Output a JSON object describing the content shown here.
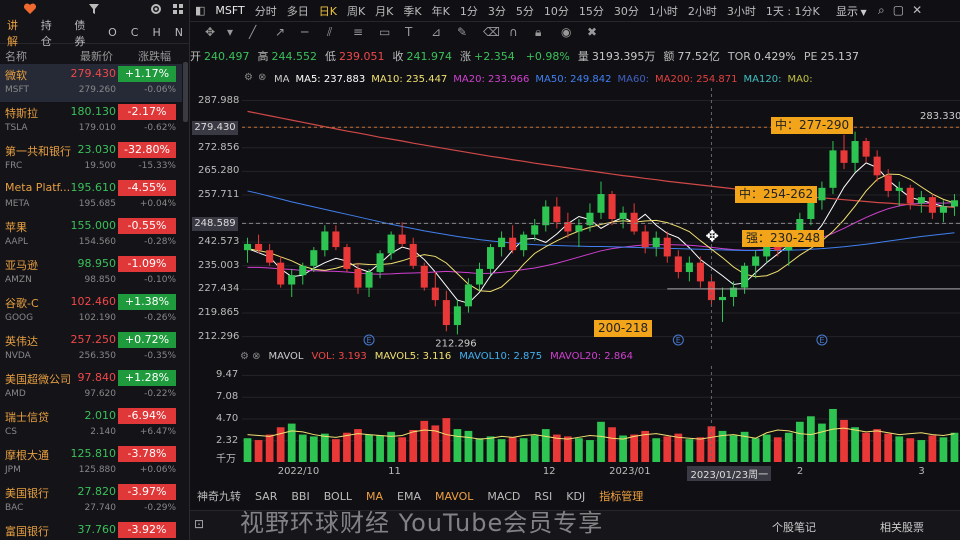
{
  "toolbar_left": {
    "heart_icon": "heart-icon",
    "filter_icon": "filter-icon",
    "gear_icon": "gear-icon",
    "grid_icon": "grid-icon"
  },
  "tabs": [
    "讲解",
    "持仓",
    "债券",
    "O",
    "C",
    "H",
    "N"
  ],
  "tab_active": 0,
  "column_headers": {
    "name": "名称",
    "price": "最新价",
    "change": "涨跌幅"
  },
  "watchlist": [
    {
      "name": "微软",
      "code": "MSFT",
      "price": "279.430",
      "pre": "279.260",
      "chg": "+1.17%",
      "chg2": "-0.06%",
      "dir": "up",
      "selected": true
    },
    {
      "name": "特斯拉",
      "code": "TSLA",
      "price": "180.130",
      "pre": "179.010",
      "chg": "-2.17%",
      "chg2": "-0.62%",
      "dir": "dn"
    },
    {
      "name": "第一共和银行",
      "code": "FRC",
      "price": "23.030",
      "pre": "19.500",
      "chg": "-32.80%",
      "chg2": "-15.33%",
      "dir": "dn"
    },
    {
      "name": "Meta Platf...",
      "code": "META",
      "price": "195.610",
      "pre": "195.685",
      "chg": "-4.55%",
      "chg2": "+0.04%",
      "dir": "dn"
    },
    {
      "name": "苹果",
      "code": "AAPL",
      "price": "155.000",
      "pre": "154.560",
      "chg": "-0.55%",
      "chg2": "-0.28%",
      "dir": "dn"
    },
    {
      "name": "亚马逊",
      "code": "AMZN",
      "price": "98.950",
      "pre": "98.850",
      "chg": "-1.09%",
      "chg2": "-0.10%",
      "dir": "dn"
    },
    {
      "name": "谷歌-C",
      "code": "GOOG",
      "price": "102.460",
      "pre": "102.190",
      "chg": "+1.38%",
      "chg2": "-0.26%",
      "dir": "up"
    },
    {
      "name": "英伟达",
      "code": "NVDA",
      "price": "257.250",
      "pre": "256.350",
      "chg": "+0.72%",
      "chg2": "-0.35%",
      "dir": "up"
    },
    {
      "name": "美国超微公司",
      "code": "AMD",
      "price": "97.840",
      "pre": "97.620",
      "chg": "+1.28%",
      "chg2": "-0.22%",
      "dir": "up"
    },
    {
      "name": "瑞士信贷",
      "code": "CS",
      "price": "2.010",
      "pre": "2.140",
      "chg": "-6.94%",
      "chg2": "+6.47%",
      "dir": "dn"
    },
    {
      "name": "摩根大通",
      "code": "JPM",
      "price": "125.810",
      "pre": "125.880",
      "chg": "-3.78%",
      "chg2": "+0.06%",
      "dir": "dn"
    },
    {
      "name": "美国银行",
      "code": "BAC",
      "price": "27.820",
      "pre": "27.740",
      "chg": "-3.97%",
      "chg2": "-0.29%",
      "dir": "dn"
    },
    {
      "name": "富国银行",
      "code": "",
      "price": "37.760",
      "pre": "",
      "chg": "-3.92%",
      "chg2": "",
      "dir": "dn"
    }
  ],
  "symbol": "MSFT",
  "periods": [
    "分时",
    "多日",
    "日K",
    "周K",
    "月K",
    "季K",
    "年K",
    "1分",
    "3分",
    "5分",
    "10分",
    "15分",
    "30分",
    "1小时",
    "2小时",
    "3小时",
    "1天 : 1分K"
  ],
  "period_active": 2,
  "top_right": {
    "display": "显示",
    "display_icon": "caret-down-icon"
  },
  "info": [
    {
      "label": "开",
      "value": "240.497",
      "cls": "dn"
    },
    {
      "label": "高",
      "value": "244.552",
      "cls": "dn"
    },
    {
      "label": "低",
      "value": "239.051",
      "cls": "up"
    },
    {
      "label": "收",
      "value": "241.974",
      "cls": "dn"
    },
    {
      "label": "涨",
      "value": "+2.354",
      "cls": "dn"
    },
    {
      "label": "",
      "value": "+0.98%",
      "cls": "dn"
    },
    {
      "label": "量",
      "value": "3193.395万",
      "cls": ""
    },
    {
      "label": "额",
      "value": "77.52亿",
      "cls": ""
    },
    {
      "label": "TOR",
      "value": "0.429%",
      "cls": ""
    },
    {
      "label": "PE",
      "value": "25.137",
      "cls": ""
    }
  ],
  "ma_labels": [
    {
      "text": "MA",
      "color": "#cccccc"
    },
    {
      "text": "MA5: 237.883",
      "color": "#ffffff"
    },
    {
      "text": "MA10: 235.447",
      "color": "#f0e070"
    },
    {
      "text": "MA20: 233.966",
      "color": "#d040d0"
    },
    {
      "text": "MA50: 249.842",
      "color": "#4080f0"
    },
    {
      "text": "MA60:",
      "color": "#4060c0"
    },
    {
      "text": "MA200: 254.871",
      "color": "#e04040"
    },
    {
      "text": "MA120:",
      "color": "#40c0c0"
    },
    {
      "text": "MA0:",
      "color": "#c0c040"
    }
  ],
  "price_ticks": [
    "287.988",
    "279.430",
    "272.856",
    "265.280",
    "257.711",
    "248.589",
    "242.573",
    "235.003",
    "227.434",
    "219.865",
    "212.296"
  ],
  "price_tick_values": [
    287.988,
    279.43,
    272.856,
    265.28,
    257.711,
    248.589,
    242.573,
    235.003,
    227.434,
    219.865,
    212.296
  ],
  "highlight_ticks": {
    "current": "279.430",
    "crosshair": "248.589"
  },
  "crosshair_value": 248.589,
  "price_annotations": {
    "high": "283.330",
    "low": "212.296"
  },
  "zones": [
    {
      "text": "中：277-290",
      "value": 280
    },
    {
      "text": "中：254-262",
      "value": 258
    },
    {
      "text": "强：230-248",
      "value": 244
    },
    {
      "text": "200-218",
      "value": 215
    }
  ],
  "vol_labels": [
    {
      "text": "MAVOL",
      "color": "#cccccc"
    },
    {
      "text": "VOL: 3.193",
      "color": "#f04848"
    },
    {
      "text": "MAVOL5: 3.116",
      "color": "#f0e070"
    },
    {
      "text": "MAVOL10: 2.875",
      "color": "#40b0f0"
    },
    {
      "text": "MAVOL20: 2.864",
      "color": "#d040d0"
    }
  ],
  "vol_ticks": [
    "9.47",
    "7.08",
    "4.70",
    "2.32",
    "千万"
  ],
  "vol_tick_values": [
    9.47,
    7.08,
    4.7,
    2.32
  ],
  "x_labels": [
    "2022/10",
    "11",
    "12",
    "2023/01",
    "2023/01/23周一",
    "2",
    "3"
  ],
  "event_marker": "E",
  "indicators": [
    "神奇九转",
    "SAR",
    "BBI",
    "BOLL",
    "MA",
    "EMA",
    "MAVOL",
    "MACD",
    "RSI",
    "KDJ",
    "指标管理"
  ],
  "indicator_active": [
    4,
    6,
    10
  ],
  "bottom_links": [
    "个股笔记",
    "相关股票"
  ],
  "watermark": "视野环球财经 YouTube会员专享",
  "chart_data": {
    "type": "candlestick",
    "title": "MSFT 日K",
    "ylim": [
      208,
      292
    ],
    "vol_ylim": [
      0,
      10.5
    ],
    "ma": {
      "ma5": [
        240.5,
        239.2,
        237.8,
        234.0,
        231.5,
        232.0,
        234.2,
        236.0,
        237.4,
        236.5,
        234.2,
        233.0,
        235.8,
        239.0,
        241.0,
        240.0,
        237.0,
        233.0,
        228.5,
        224.0,
        223.0,
        226.5,
        231.8,
        235.8,
        240.0,
        243.5,
        243.8,
        242.5,
        245.2,
        248.5,
        250.8,
        249.8,
        247.0,
        249.0,
        250.5,
        248.8,
        251.5,
        248.0,
        245.4,
        244.0,
        240.8,
        237.0,
        234.4,
        231.8,
        229.0,
        229.5,
        232.8,
        236.0,
        238.8,
        241.6,
        242.8,
        243.8,
        248.0,
        254.0,
        260.2,
        264.8,
        268.0,
        266.5,
        262.5,
        259.6,
        256.9,
        256.0,
        255.0,
        254.0,
        253.8
      ],
      "ma20": [
        234.5,
        234.5,
        234.3,
        234.0,
        233.8,
        233.5,
        233.4,
        233.3,
        233.2,
        233.0,
        232.7,
        232.4,
        232.3,
        232.4,
        232.6,
        232.7,
        232.8,
        233.0,
        233.2,
        233.0,
        232.8,
        232.5,
        232.6,
        232.9,
        233.3,
        233.8,
        234.3,
        235.0,
        235.8,
        236.8,
        237.8,
        238.8,
        239.8,
        240.5,
        241.0,
        241.4,
        241.7,
        241.8,
        241.8,
        241.7,
        241.6,
        241.3,
        240.9,
        240.5,
        240.2,
        240.0,
        240.0,
        240.3,
        240.8,
        241.4,
        242.0,
        242.9,
        244.0,
        245.4,
        247.0,
        248.8,
        250.5,
        252.0,
        253.3,
        254.2,
        254.8,
        255.0,
        255.1,
        255.1,
        255.2
      ],
      "ma50": [
        259.0,
        258.2,
        257.3,
        256.4,
        255.5,
        254.7,
        253.9,
        253.1,
        252.3,
        251.5,
        250.7,
        249.9,
        249.1,
        248.3,
        247.6,
        246.9,
        246.2,
        245.6,
        245.0,
        244.4,
        243.9,
        243.4,
        243.0,
        242.6,
        242.3,
        242.0,
        241.8,
        241.6,
        241.5,
        241.4,
        241.3,
        241.2,
        241.2,
        241.1,
        241.0,
        240.9,
        240.8,
        240.7,
        240.6,
        240.5,
        240.4,
        240.3,
        240.2,
        240.1,
        240.0,
        239.9,
        239.9,
        239.9,
        239.9,
        240.0,
        240.1,
        240.3,
        240.5,
        240.8,
        241.1,
        241.5,
        241.9,
        242.4,
        242.9,
        243.4,
        243.9,
        244.4,
        244.8,
        245.2,
        245.6
      ],
      "ma200": [
        284.5,
        283.8,
        283.1,
        282.4,
        281.7,
        281.0,
        280.3,
        279.6,
        278.9,
        278.2,
        277.6,
        276.9,
        276.2,
        275.6,
        275.0,
        274.3,
        273.7,
        273.1,
        272.5,
        271.9,
        271.3,
        270.7,
        270.1,
        269.6,
        269.0,
        268.5,
        267.9,
        267.4,
        266.9,
        266.4,
        265.9,
        265.4,
        264.9,
        264.4,
        263.9,
        263.5,
        263.0,
        262.6,
        262.1,
        261.7,
        261.3,
        260.9,
        260.5,
        260.1,
        259.7,
        259.3,
        258.9,
        258.5,
        258.2,
        257.8,
        257.5,
        257.1,
        256.8,
        256.5,
        256.2,
        255.9,
        255.6,
        255.3,
        255.1,
        254.8,
        254.6,
        254.3,
        254.1,
        253.9,
        253.7
      ]
    },
    "volume_mavol5": [
      3.0,
      2.9,
      2.8,
      3.1,
      3.4,
      3.3,
      3.0,
      2.8,
      2.7,
      2.9,
      3.1,
      3.0,
      2.9,
      2.8,
      2.9,
      3.3,
      3.5,
      3.4,
      3.0,
      2.8,
      2.7,
      2.5,
      2.6,
      2.8,
      2.7,
      2.9,
      3.0,
      2.8,
      2.6,
      2.5,
      2.7,
      2.9,
      2.8,
      2.6,
      2.5,
      2.8,
      3.0,
      3.1,
      2.9,
      2.7,
      2.6,
      2.5,
      2.7,
      2.9,
      3.0,
      2.8,
      2.6,
      3.2,
      3.5,
      3.4,
      3.1,
      3.0,
      3.3,
      3.6,
      3.7,
      3.5,
      3.3,
      3.4,
      3.2,
      3.0,
      3.1,
      3.2,
      3.0,
      2.9,
      3.1
    ],
    "candles": [
      {
        "o": 240,
        "h": 244,
        "l": 236,
        "c": 242,
        "v": 2.6
      },
      {
        "o": 242,
        "h": 245,
        "l": 239,
        "c": 240,
        "v": 2.4
      },
      {
        "o": 240,
        "h": 242,
        "l": 235,
        "c": 236,
        "v": 3.0
      },
      {
        "o": 236,
        "h": 238,
        "l": 228,
        "c": 229,
        "v": 3.8
      },
      {
        "o": 229,
        "h": 234,
        "l": 225,
        "c": 232,
        "v": 4.2
      },
      {
        "o": 232,
        "h": 236,
        "l": 229,
        "c": 235,
        "v": 3.0
      },
      {
        "o": 235,
        "h": 241,
        "l": 233,
        "c": 240,
        "v": 2.8
      },
      {
        "o": 240,
        "h": 248,
        "l": 238,
        "c": 246,
        "v": 3.1
      },
      {
        "o": 246,
        "h": 248,
        "l": 240,
        "c": 241,
        "v": 2.5
      },
      {
        "o": 241,
        "h": 242,
        "l": 233,
        "c": 234,
        "v": 3.2
      },
      {
        "o": 234,
        "h": 236,
        "l": 226,
        "c": 228,
        "v": 3.6
      },
      {
        "o": 228,
        "h": 234,
        "l": 225,
        "c": 233,
        "v": 3.0
      },
      {
        "o": 233,
        "h": 240,
        "l": 231,
        "c": 239,
        "v": 2.9
      },
      {
        "o": 239,
        "h": 246,
        "l": 237,
        "c": 245,
        "v": 3.3
      },
      {
        "o": 245,
        "h": 249,
        "l": 241,
        "c": 242,
        "v": 2.7
      },
      {
        "o": 242,
        "h": 244,
        "l": 234,
        "c": 235,
        "v": 3.5
      },
      {
        "o": 235,
        "h": 236,
        "l": 227,
        "c": 228,
        "v": 4.5
      },
      {
        "o": 228,
        "h": 233,
        "l": 222,
        "c": 224,
        "v": 4.0
      },
      {
        "o": 224,
        "h": 227,
        "l": 214,
        "c": 216,
        "v": 4.8
      },
      {
        "o": 216,
        "h": 224,
        "l": 213,
        "c": 222,
        "v": 3.6
      },
      {
        "o": 222,
        "h": 231,
        "l": 220,
        "c": 229,
        "v": 3.4
      },
      {
        "o": 229,
        "h": 236,
        "l": 227,
        "c": 234,
        "v": 2.6
      },
      {
        "o": 234,
        "h": 242,
        "l": 232,
        "c": 241,
        "v": 2.8
      },
      {
        "o": 241,
        "h": 246,
        "l": 238,
        "c": 244,
        "v": 2.5
      },
      {
        "o": 244,
        "h": 248,
        "l": 239,
        "c": 240,
        "v": 2.7
      },
      {
        "o": 240,
        "h": 246,
        "l": 238,
        "c": 245,
        "v": 2.6
      },
      {
        "o": 245,
        "h": 250,
        "l": 243,
        "c": 248,
        "v": 2.9
      },
      {
        "o": 248,
        "h": 256,
        "l": 246,
        "c": 254,
        "v": 3.6
      },
      {
        "o": 254,
        "h": 257,
        "l": 247,
        "c": 249,
        "v": 3.0
      },
      {
        "o": 249,
        "h": 252,
        "l": 244,
        "c": 246,
        "v": 2.8
      },
      {
        "o": 246,
        "h": 250,
        "l": 241,
        "c": 248,
        "v": 2.6
      },
      {
        "o": 248,
        "h": 255,
        "l": 246,
        "c": 252,
        "v": 2.4
      },
      {
        "o": 252,
        "h": 262,
        "l": 250,
        "c": 258,
        "v": 4.4
      },
      {
        "o": 258,
        "h": 259,
        "l": 248,
        "c": 250,
        "v": 3.8
      },
      {
        "o": 250,
        "h": 254,
        "l": 247,
        "c": 252,
        "v": 2.9
      },
      {
        "o": 252,
        "h": 255,
        "l": 245,
        "c": 246,
        "v": 3.0
      },
      {
        "o": 246,
        "h": 248,
        "l": 239,
        "c": 241,
        "v": 3.4
      },
      {
        "o": 241,
        "h": 246,
        "l": 238,
        "c": 244,
        "v": 2.6
      },
      {
        "o": 244,
        "h": 246,
        "l": 236,
        "c": 238,
        "v": 2.8
      },
      {
        "o": 238,
        "h": 240,
        "l": 231,
        "c": 233,
        "v": 3.1
      },
      {
        "o": 233,
        "h": 238,
        "l": 230,
        "c": 236,
        "v": 2.5
      },
      {
        "o": 236,
        "h": 238,
        "l": 228,
        "c": 230,
        "v": 2.7
      },
      {
        "o": 230,
        "h": 232,
        "l": 222,
        "c": 224,
        "v": 3.9
      },
      {
        "o": 224,
        "h": 228,
        "l": 217,
        "c": 225,
        "v": 3.4
      },
      {
        "o": 225,
        "h": 230,
        "l": 222,
        "c": 228,
        "v": 2.9
      },
      {
        "o": 228,
        "h": 236,
        "l": 226,
        "c": 235,
        "v": 3.3
      },
      {
        "o": 235,
        "h": 240,
        "l": 231,
        "c": 238,
        "v": 2.6
      },
      {
        "o": 238,
        "h": 244,
        "l": 236,
        "c": 242,
        "v": 3.0
      },
      {
        "o": 242,
        "h": 246,
        "l": 238,
        "c": 240,
        "v": 2.7
      },
      {
        "o": 240,
        "h": 244,
        "l": 235,
        "c": 243,
        "v": 3.2
      },
      {
        "o": 243,
        "h": 252,
        "l": 241,
        "c": 250,
        "v": 4.4
      },
      {
        "o": 250,
        "h": 257,
        "l": 248,
        "c": 256,
        "v": 5.0
      },
      {
        "o": 256,
        "h": 262,
        "l": 253,
        "c": 260,
        "v": 4.2
      },
      {
        "o": 260,
        "h": 275,
        "l": 258,
        "c": 272,
        "v": 5.8
      },
      {
        "o": 272,
        "h": 277,
        "l": 266,
        "c": 268,
        "v": 4.6
      },
      {
        "o": 268,
        "h": 278,
        "l": 265,
        "c": 275,
        "v": 3.8
      },
      {
        "o": 275,
        "h": 276,
        "l": 268,
        "c": 270,
        "v": 3.2
      },
      {
        "o": 270,
        "h": 272,
        "l": 262,
        "c": 264,
        "v": 3.6
      },
      {
        "o": 264,
        "h": 266,
        "l": 257,
        "c": 259,
        "v": 3.1
      },
      {
        "o": 259,
        "h": 262,
        "l": 254,
        "c": 260,
        "v": 2.8
      },
      {
        "o": 260,
        "h": 261,
        "l": 253,
        "c": 255,
        "v": 2.6
      },
      {
        "o": 255,
        "h": 259,
        "l": 252,
        "c": 257,
        "v": 2.4
      },
      {
        "o": 257,
        "h": 258,
        "l": 250,
        "c": 252,
        "v": 2.9
      },
      {
        "o": 252,
        "h": 256,
        "l": 249,
        "c": 254,
        "v": 2.7
      },
      {
        "o": 254,
        "h": 258,
        "l": 251,
        "c": 256,
        "v": 3.2
      }
    ]
  }
}
